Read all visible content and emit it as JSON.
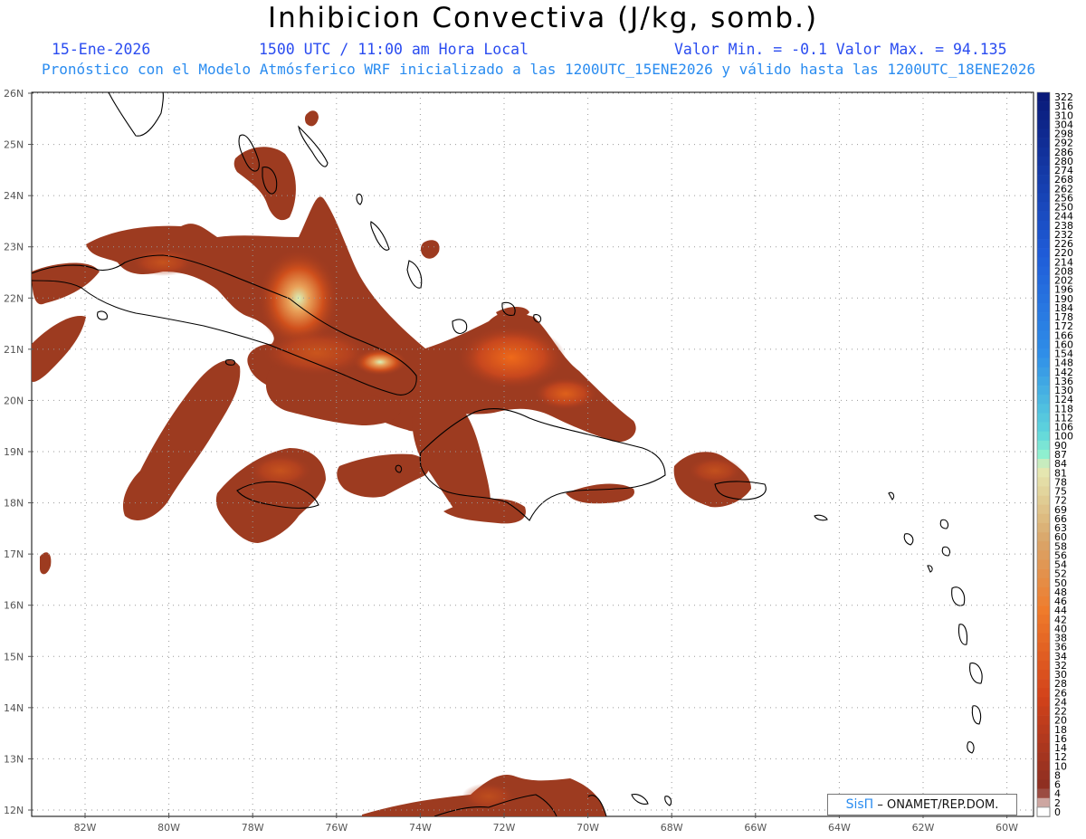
{
  "header": {
    "title": "Inhibicion Convectiva (J/kg, somb.)",
    "date": "15-Ene-2026",
    "time": "1500 UTC / 11:00 am Hora Local",
    "min_max": "Valor Min. = -0.1  Valor Max. = 94.135",
    "model_info": "Pronóstico con el Modelo Atmósferico WRF inicializado a las 1200UTC_15ENE2026 y válido hasta las  1200UTC_18ENE2026"
  },
  "credit": {
    "logo": "SisΠ",
    "text": "– ONAMET/REP.DOM."
  },
  "map": {
    "lat_labels": [
      "26N",
      "25N",
      "24N",
      "23N",
      "22N",
      "21N",
      "20N",
      "19N",
      "18N",
      "17N",
      "16N",
      "15N",
      "14N",
      "13N",
      "12N"
    ],
    "lon_labels": [
      "82W",
      "80W",
      "78W",
      "76W",
      "74W",
      "72W",
      "70W",
      "68W",
      "66W",
      "64W",
      "62W",
      "60W"
    ],
    "lat_range": [
      12,
      26
    ],
    "lon_range": [
      -83.2,
      -59.8
    ],
    "grid": "dotted",
    "field_color": "#9a3a20",
    "coast_color": "#000000"
  },
  "colorbar": {
    "labels": [
      "322",
      "316",
      "310",
      "304",
      "298",
      "292",
      "286",
      "280",
      "274",
      "268",
      "262",
      "256",
      "250",
      "244",
      "238",
      "232",
      "226",
      "220",
      "214",
      "208",
      "202",
      "196",
      "190",
      "184",
      "178",
      "172",
      "166",
      "160",
      "154",
      "148",
      "142",
      "136",
      "130",
      "124",
      "118",
      "112",
      "106",
      "100",
      "90",
      "87",
      "84",
      "81",
      "78",
      "75",
      "72",
      "69",
      "66",
      "63",
      "60",
      "58",
      "56",
      "54",
      "52",
      "50",
      "48",
      "46",
      "44",
      "42",
      "40",
      "38",
      "36",
      "34",
      "32",
      "30",
      "28",
      "26",
      "24",
      "22",
      "20",
      "18",
      "16",
      "14",
      "12",
      "10",
      "8",
      "6",
      "4",
      "2",
      "0"
    ]
  }
}
